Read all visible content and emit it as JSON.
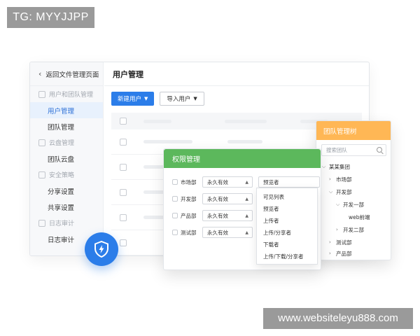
{
  "watermarks": {
    "top_left": "TG: MYYJJPP",
    "bottom_right": "www.websiteleyu888.com"
  },
  "sidebar": {
    "back_label": "返回文件管理页面",
    "groups": [
      {
        "title": "用户和团队管理",
        "items": [
          "用户管理",
          "团队管理"
        ]
      },
      {
        "title": "云盘管理",
        "items": [
          "团队云盘"
        ]
      },
      {
        "title": "安全策略",
        "items": [
          "分享设置",
          "共享设置"
        ]
      },
      {
        "title": "日志审计",
        "items": [
          "日志审计"
        ]
      }
    ],
    "active_item": "用户管理"
  },
  "main": {
    "title": "用户管理",
    "new_user_button": "新建用户",
    "import_user_button": "导入用户"
  },
  "permissions_panel": {
    "title": "权限管理",
    "rows": [
      {
        "dept": "市场部",
        "validity": "永久有效",
        "role": "预览者"
      },
      {
        "dept": "开发部",
        "validity": "永久有效"
      },
      {
        "dept": "产品部",
        "validity": "永久有效"
      },
      {
        "dept": "测试部",
        "validity": "永久有效"
      }
    ],
    "role_options": [
      "可见列表",
      "预览者",
      "上传者",
      "上传/分享者",
      "下载者",
      "上传/下载/分享者"
    ]
  },
  "team_tree": {
    "title": "团队管理树",
    "search_placeholder": "搜索团队",
    "nodes": [
      "某某集团",
      "市场部",
      "开发部",
      "开发一部",
      "web前端",
      "开发二部",
      "测试部",
      "产品部"
    ]
  },
  "colors": {
    "primary": "#2b7de9",
    "permission_header": "#5cb85c",
    "tree_header": "#ffb755",
    "active_nav_bg": "#e8f1fd"
  },
  "icons": [
    "chevron-left-icon",
    "users-icon",
    "cloud-icon",
    "shield-icon",
    "log-icon",
    "caret-down-icon",
    "search-icon",
    "shield-lightning-icon"
  ]
}
